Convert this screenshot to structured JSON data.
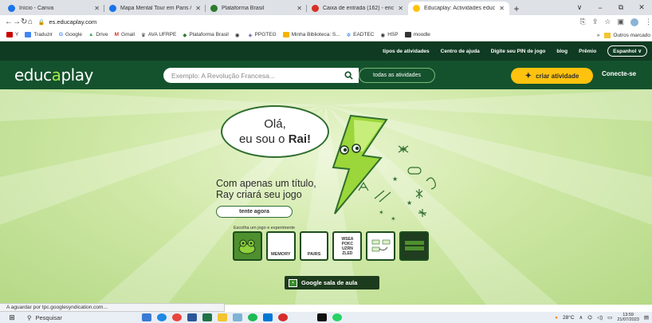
{
  "browser": {
    "tabs": [
      {
        "label": "Início - Canva",
        "favicon_color": "#1a73e8"
      },
      {
        "label": "Mapa Mental Tour em Paris /",
        "favicon_color": "#1a73e8"
      },
      {
        "label": "Plataforma Brasil",
        "favicon_color": "#2c7a2c"
      },
      {
        "label": "Caixa de entrada (162) - eric",
        "favicon_color": "#d93025"
      },
      {
        "label": "Educaplay: Actividades educ",
        "favicon_color": "#ffc20e"
      }
    ],
    "new_tab_label": "+",
    "window_controls": [
      "∨",
      "−",
      "⧉",
      "✕"
    ],
    "url": "es.educaplay.com",
    "bookmarks": [
      {
        "label": "Y",
        "color": "#cc0000"
      },
      {
        "label": "Traduzir",
        "color": "#4285f4"
      },
      {
        "label": "Google",
        "color": "#4285f4"
      },
      {
        "label": "Drive",
        "color": "#34a853"
      },
      {
        "label": "Gmail",
        "color": "#d93025"
      },
      {
        "label": "AVA UFRPE",
        "color": "#333333"
      },
      {
        "label": "Plataforma Brasil",
        "color": "#2c7a2c"
      },
      {
        "label": "",
        "color": "#555555"
      },
      {
        "label": "PPGTEG",
        "color": "#6a4a9a"
      },
      {
        "label": "Minha Biblioteca: S...",
        "color": "#f4b400"
      },
      {
        "label": "EADTEC",
        "color": "#1a73e8"
      },
      {
        "label": "HSP",
        "color": "#555555"
      },
      {
        "label": "moodle",
        "color": "#333333"
      }
    ],
    "bookmarks_more": "»",
    "other_bookmarks": "Outros marcado"
  },
  "site": {
    "topbar": [
      "tipos de atividades",
      "Centro de ajuda",
      "Digite seu PIN de jogo",
      "blog",
      "Prêmio"
    ],
    "language": "Espanhol ∨",
    "logo_left": "educ",
    "logo_mid": "a",
    "logo_right": "play",
    "search_placeholder": "Exemplo: A Revolução Francesa...",
    "search_icon": "search-icon",
    "all_activities": "todas as atividades",
    "create_activity": "criar atividade",
    "connect": "Conecte-se"
  },
  "hero": {
    "bubble_line1": "Olá,",
    "bubble_line2_a": "eu sou o ",
    "bubble_line2_b": "Rai!",
    "tagline_line1": "Com apenas um título,",
    "tagline_line2": "Ray criará seu jogo",
    "try_button": "tente agora",
    "choose_label": "Escolha um jogo e experimente",
    "games": [
      {
        "label": "",
        "style": "green"
      },
      {
        "label": "MEMORY",
        "style": "light"
      },
      {
        "label": "PAIRS",
        "style": "light"
      },
      {
        "label": "WSEA\nPOKC\nUZRN\nZLED",
        "style": "light"
      },
      {
        "label": "",
        "style": "light"
      },
      {
        "label": "",
        "style": "dark"
      }
    ],
    "classroom_button": "Google sala de aula"
  },
  "status_text": "A aguardar por tpc.googlesyndication.com...",
  "taskbar": {
    "search": "Pesquisar",
    "temperature": "28°C",
    "time": "13:59",
    "date": "21/07/2023"
  }
}
